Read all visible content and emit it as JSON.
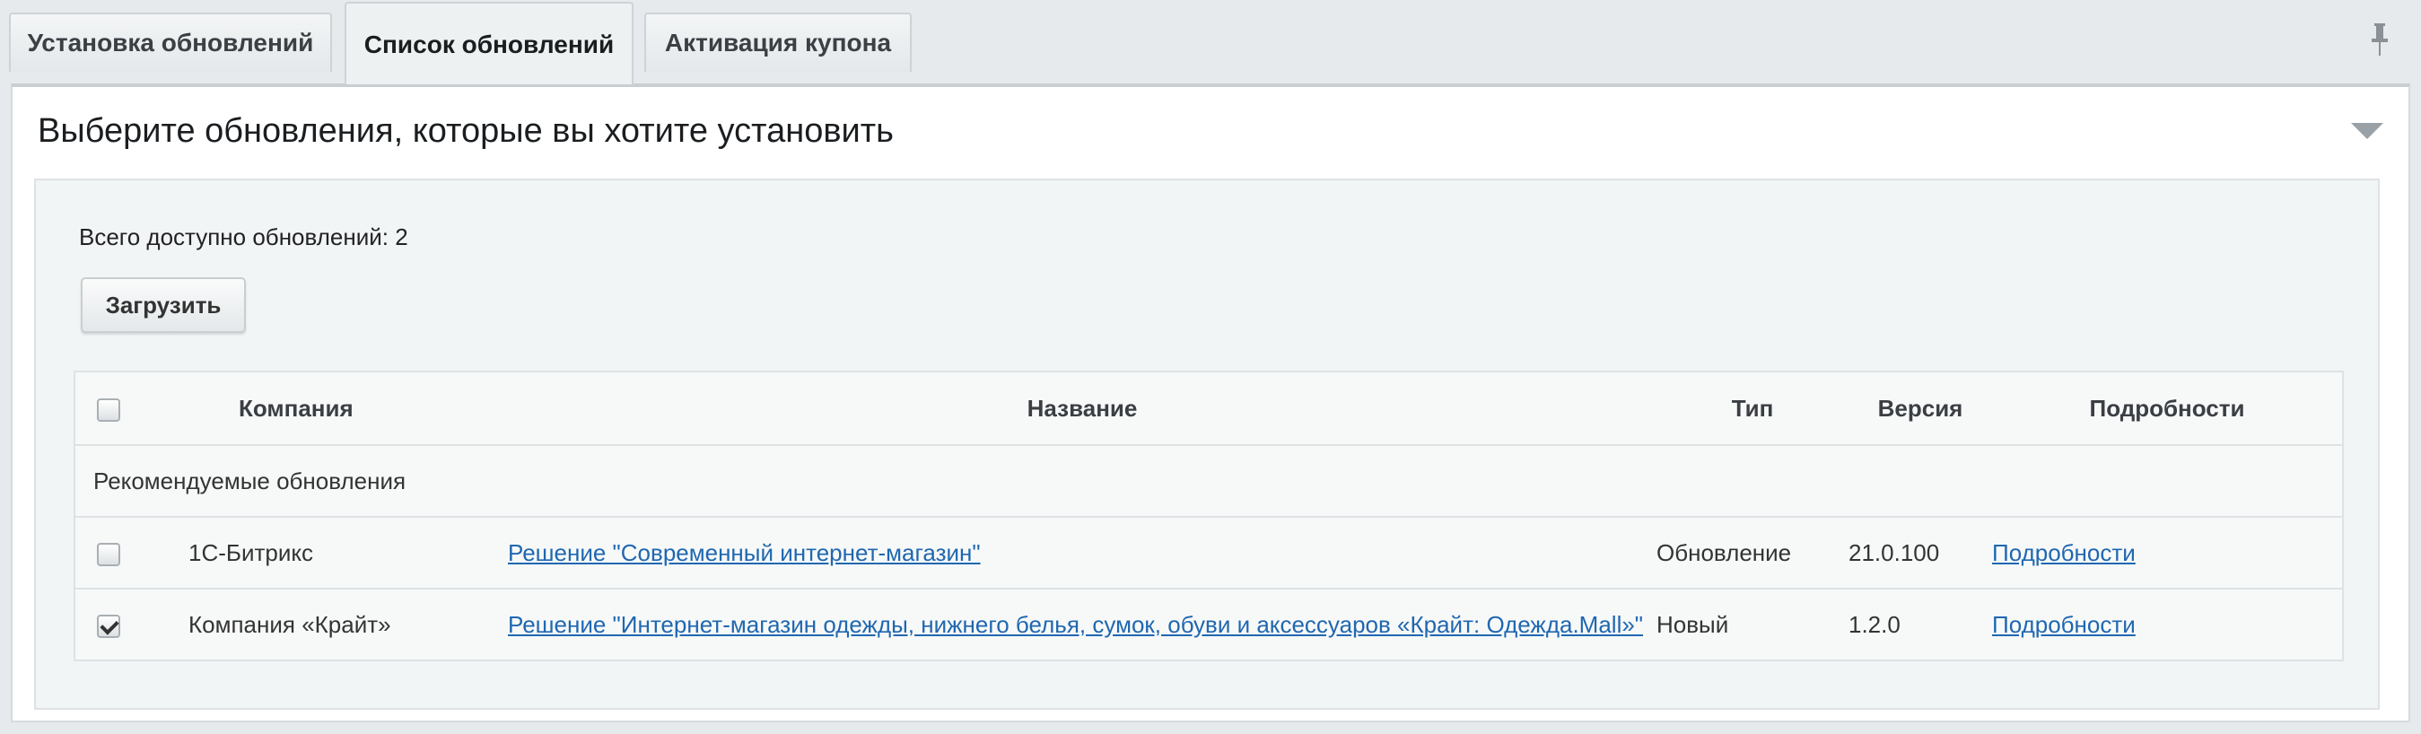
{
  "tabs": [
    {
      "label": "Установка обновлений",
      "active": false
    },
    {
      "label": "Список обновлений",
      "active": true
    },
    {
      "label": "Активация купона",
      "active": false
    }
  ],
  "icons": {
    "pin": "pin-icon",
    "collapse": "chevron-down-icon"
  },
  "page": {
    "title": "Выберите обновления, которые вы хотите установить",
    "total_text": "Всего доступно обновлений: 2",
    "load_button": "Загрузить"
  },
  "table": {
    "headers": {
      "company": "Компания",
      "name": "Название",
      "type": "Тип",
      "version": "Версия",
      "details": "Подробности"
    },
    "group_label": "Рекомендуемые обновления",
    "rows": [
      {
        "checked": false,
        "company": "1С-Битрикс",
        "name": "Решение \"Современный интернет-магазин\"",
        "type": "Обновление",
        "version": "21.0.100",
        "details": "Подробности"
      },
      {
        "checked": true,
        "company": "Компания «Крайт»",
        "name": "Решение \"Интернет-магазин одежды, нижнего белья, сумок, обуви и аксессуаров «Крайт: Одежда.Mall»\"",
        "type": "Новый",
        "version": "1.2.0",
        "details": "Подробности"
      }
    ]
  },
  "colors": {
    "link": "#2067b0",
    "background": "#e6eaec"
  }
}
